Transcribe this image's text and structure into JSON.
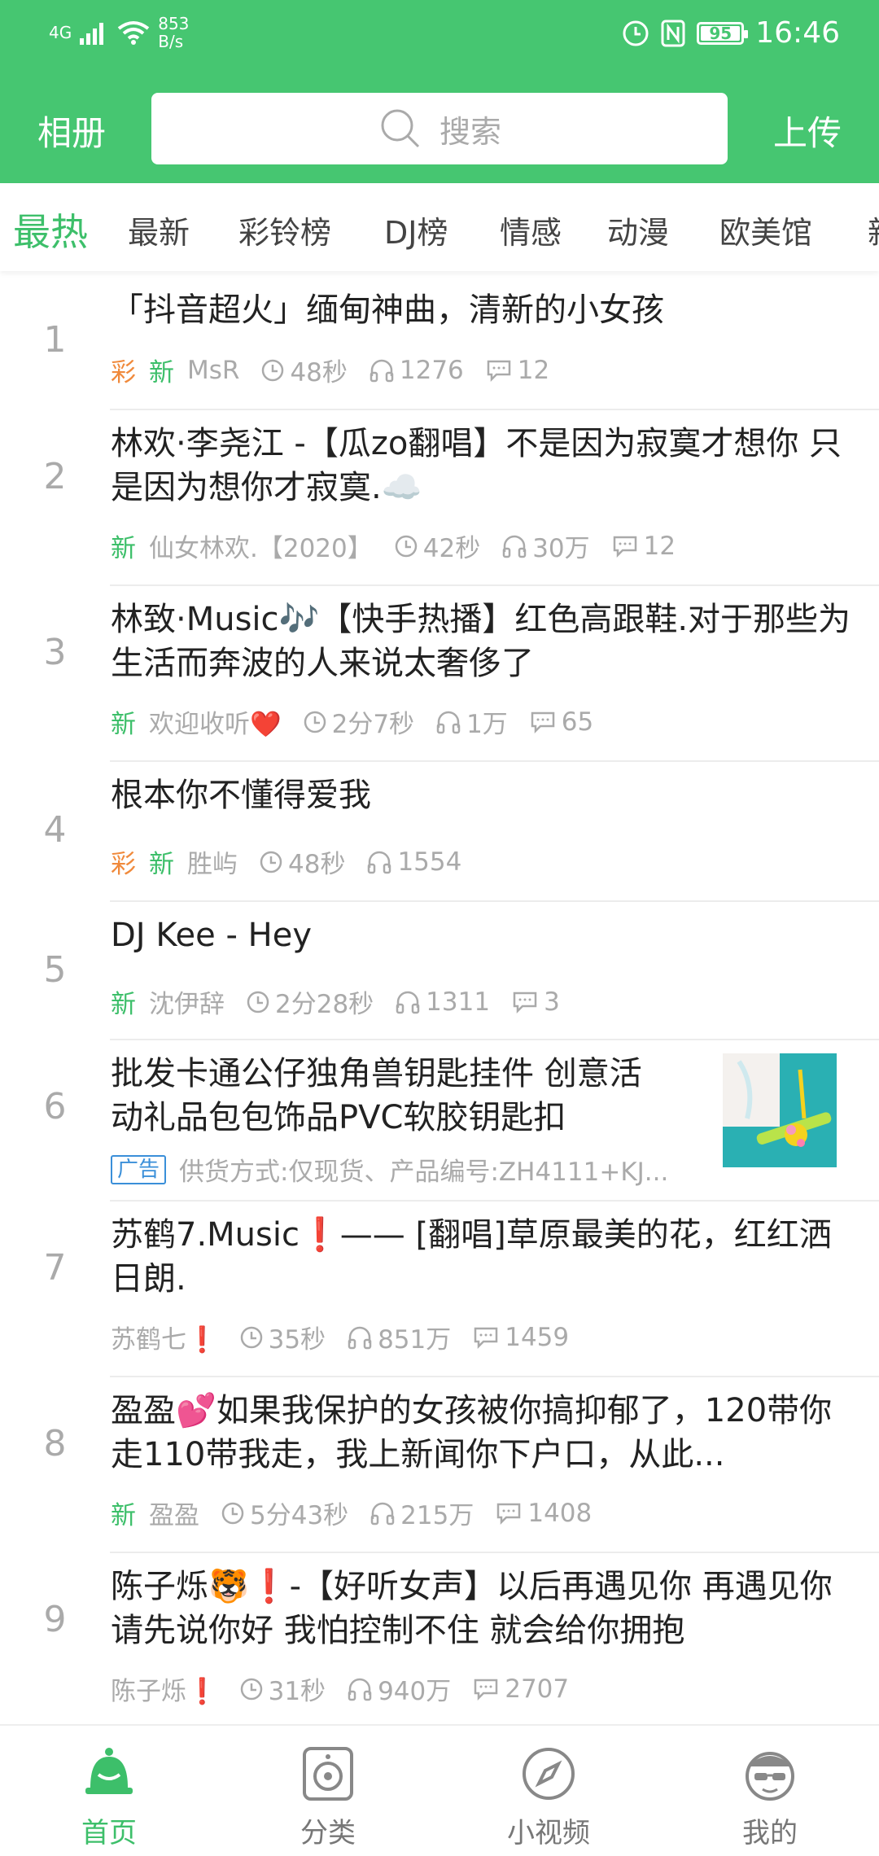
{
  "status_bar": {
    "network": "4G",
    "speed_value": "853",
    "speed_unit": "B/s",
    "battery": "95",
    "time": "16:46"
  },
  "top_bar": {
    "album": "相册",
    "search_placeholder": "搜索",
    "upload": "上传"
  },
  "tabs": [
    "最热",
    "最新",
    "彩铃榜",
    "DJ榜",
    "情感",
    "动漫",
    "欧美馆",
    "新"
  ],
  "items": [
    {
      "rank": "1",
      "title": "「抖音超火」缅甸神曲，清新的小女孩",
      "cai": "彩",
      "new": "新",
      "author": "MsR",
      "duration": "48秒",
      "plays": "1276",
      "comments": "12"
    },
    {
      "rank": "2",
      "title": "林欢·李尧江 -【瓜zo翻唱】不是因为寂寞才想你 只是因为想你才寂寞.☁️",
      "new": "新",
      "author": "仙女林欢.【2020】",
      "duration": "42秒",
      "plays": "30万",
      "comments": "12"
    },
    {
      "rank": "3",
      "title": "林致·Music🎶【快手热播】红色高跟鞋.对于那些为生活而奔波的人来说太奢侈了",
      "new": "新",
      "author": "欢迎收听❤️",
      "duration": "2分7秒",
      "plays": "1万",
      "comments": "65"
    },
    {
      "rank": "4",
      "title": "根本你不懂得爱我",
      "cai": "彩",
      "new": "新",
      "author": "胜屿",
      "duration": "48秒",
      "plays": "1554"
    },
    {
      "rank": "5",
      "title": "DJ Kee - Hey",
      "new": "新",
      "author": "沈伊辞",
      "duration": "2分28秒",
      "plays": "1311",
      "comments": "3"
    },
    {
      "rank": "6",
      "title": "批发卡通公仔独角兽钥匙挂件 创意活动礼品包包饰品PVC软胶钥匙扣",
      "ad_tag": "广告",
      "ad_desc": "供货方式:仅现货、产品编号:ZH4111+KJ..."
    },
    {
      "rank": "7",
      "title": "苏鹤7.Music❗—— [翻唱]草原最美的花，红红洒日朗.",
      "author": "苏鹤七❗",
      "duration": "35秒",
      "plays": "851万",
      "comments": "1459"
    },
    {
      "rank": "8",
      "title": "盈盈💕如果我保护的女孩被你搞抑郁了，120带你走110带我走，我上新闻你下户口，从此...",
      "new": "新",
      "author": "盈盈",
      "duration": "5分43秒",
      "plays": "215万",
      "comments": "1408"
    },
    {
      "rank": "9",
      "title": "陈子烁🐯❗-【好听女声】以后再遇见你 再遇见你 请先说你好 我怕控制不住 就会给你拥抱",
      "author": "陈子烁❗",
      "duration": "31秒",
      "plays": "940万",
      "comments": "2707"
    }
  ],
  "bottom_nav": {
    "home": "首页",
    "category": "分类",
    "video": "小视频",
    "mine": "我的"
  },
  "colors": {
    "brand_green": "#46c671",
    "active_green": "#3dbf6a",
    "cai_orange": "#f08a3c",
    "ad_blue": "#3a8fd9"
  },
  "icons": {
    "duration": "clock-icon",
    "plays": "headphones-icon",
    "comments": "comment-icon"
  }
}
